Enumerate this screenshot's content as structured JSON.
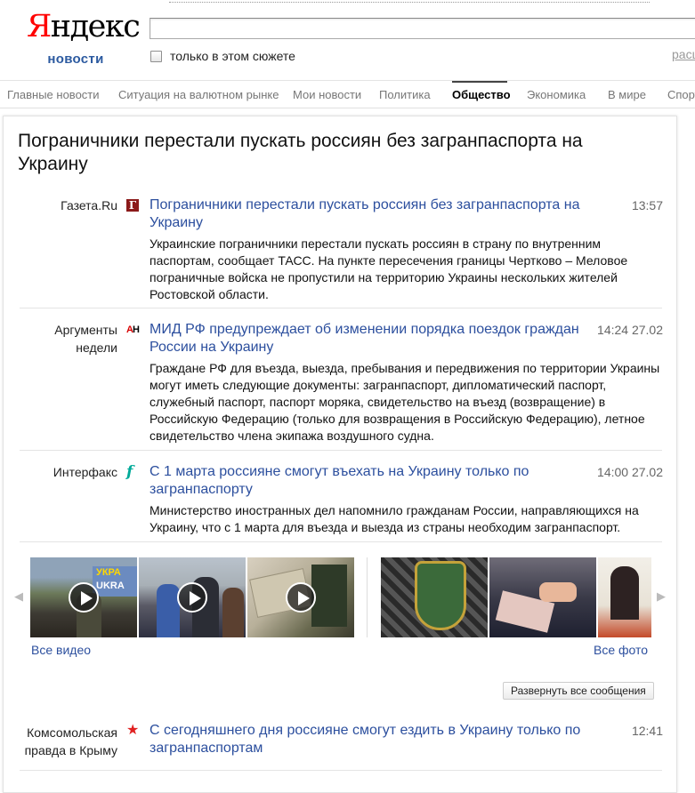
{
  "brand": {
    "logo_first": "Я",
    "logo_rest": "ндекс",
    "subtitle": "новости"
  },
  "search": {
    "value": "",
    "filter_label": "только в этом сюжете",
    "advanced_link": "расш"
  },
  "nav": {
    "tabs": [
      {
        "label": "Главные новости",
        "active": false
      },
      {
        "label": "Ситуация на валютном рынке",
        "active": false
      },
      {
        "label": "Мои новости",
        "active": false
      },
      {
        "label": "Политика",
        "active": false
      },
      {
        "label": "Общество",
        "active": true
      },
      {
        "label": "Экономика",
        "active": false
      },
      {
        "label": "В мире",
        "active": false
      },
      {
        "label": "Спорт",
        "active": false
      }
    ]
  },
  "story": {
    "title": "Пограничники перестали пускать россиян без загранпаспорта на Украину",
    "items": [
      {
        "source": "Газета.Ru",
        "icon": "gazeta-icon",
        "icon_text": "Г",
        "title": "Пограничники перестали пускать россиян без загранпаспорта на Украину",
        "time": "13:57",
        "snippet": "Украинские пограничники перестали пускать россиян в страну по внутренним паспортам, сообщает ТАСС. На пункте пересечения границы Чертково – Меловое пограничные войска не пропустили на территорию Украины нескольких жителей Ростовской области."
      },
      {
        "source": "Аргументы недели",
        "icon": "aif-icon",
        "icon_text": "АН",
        "title": "МИД РФ предупреждает об изменении порядка поездок граждан России на Украину",
        "time": "14:24 27.02",
        "snippet": "Граждане РФ для въезда, выезда, пребывания и передвижения по территории Украины могут иметь следующие документы: загранпаспорт, дипломатический паспорт, служебный паспорт, паспорт моряка, свидетельство на въезд (возвращение) в Российскую Федерацию (только для возвращения в Российскую Федерацию), летное свидетельство члена экипажа воздушного судна."
      },
      {
        "source": "Интерфакс",
        "icon": "interfax-icon",
        "icon_text": "f",
        "title": "С 1 марта россияне смогут въехать на Украину только по загранпаспорту",
        "time": "14:00 27.02",
        "snippet": "Министерство иностранных дел напомнило гражданам России, направляющихся на Украину, что с 1 марта для въезда и выезда из страны необходим загранпаспорт."
      },
      {
        "source": "Комсомольская правда в Крыму",
        "icon": "kp-icon",
        "icon_text": "★",
        "title": "С сегодняшнего дня россияне смогут ездить в Украину только по загранпаспортам",
        "time": "12:41",
        "snippet": ""
      }
    ]
  },
  "media": {
    "all_video": "Все видео",
    "all_photo": "Все фото",
    "video_thumb_text": "УКРА",
    "video_thumb_text2": "UKRA",
    "prev_arrow": "◀",
    "next_arrow": "▶"
  },
  "expand_button": "Развернуть все сообщения",
  "colors": {
    "link": "#2c4f9e",
    "brand_red": "#ff0000",
    "brand_blue": "#2c5aa0"
  }
}
